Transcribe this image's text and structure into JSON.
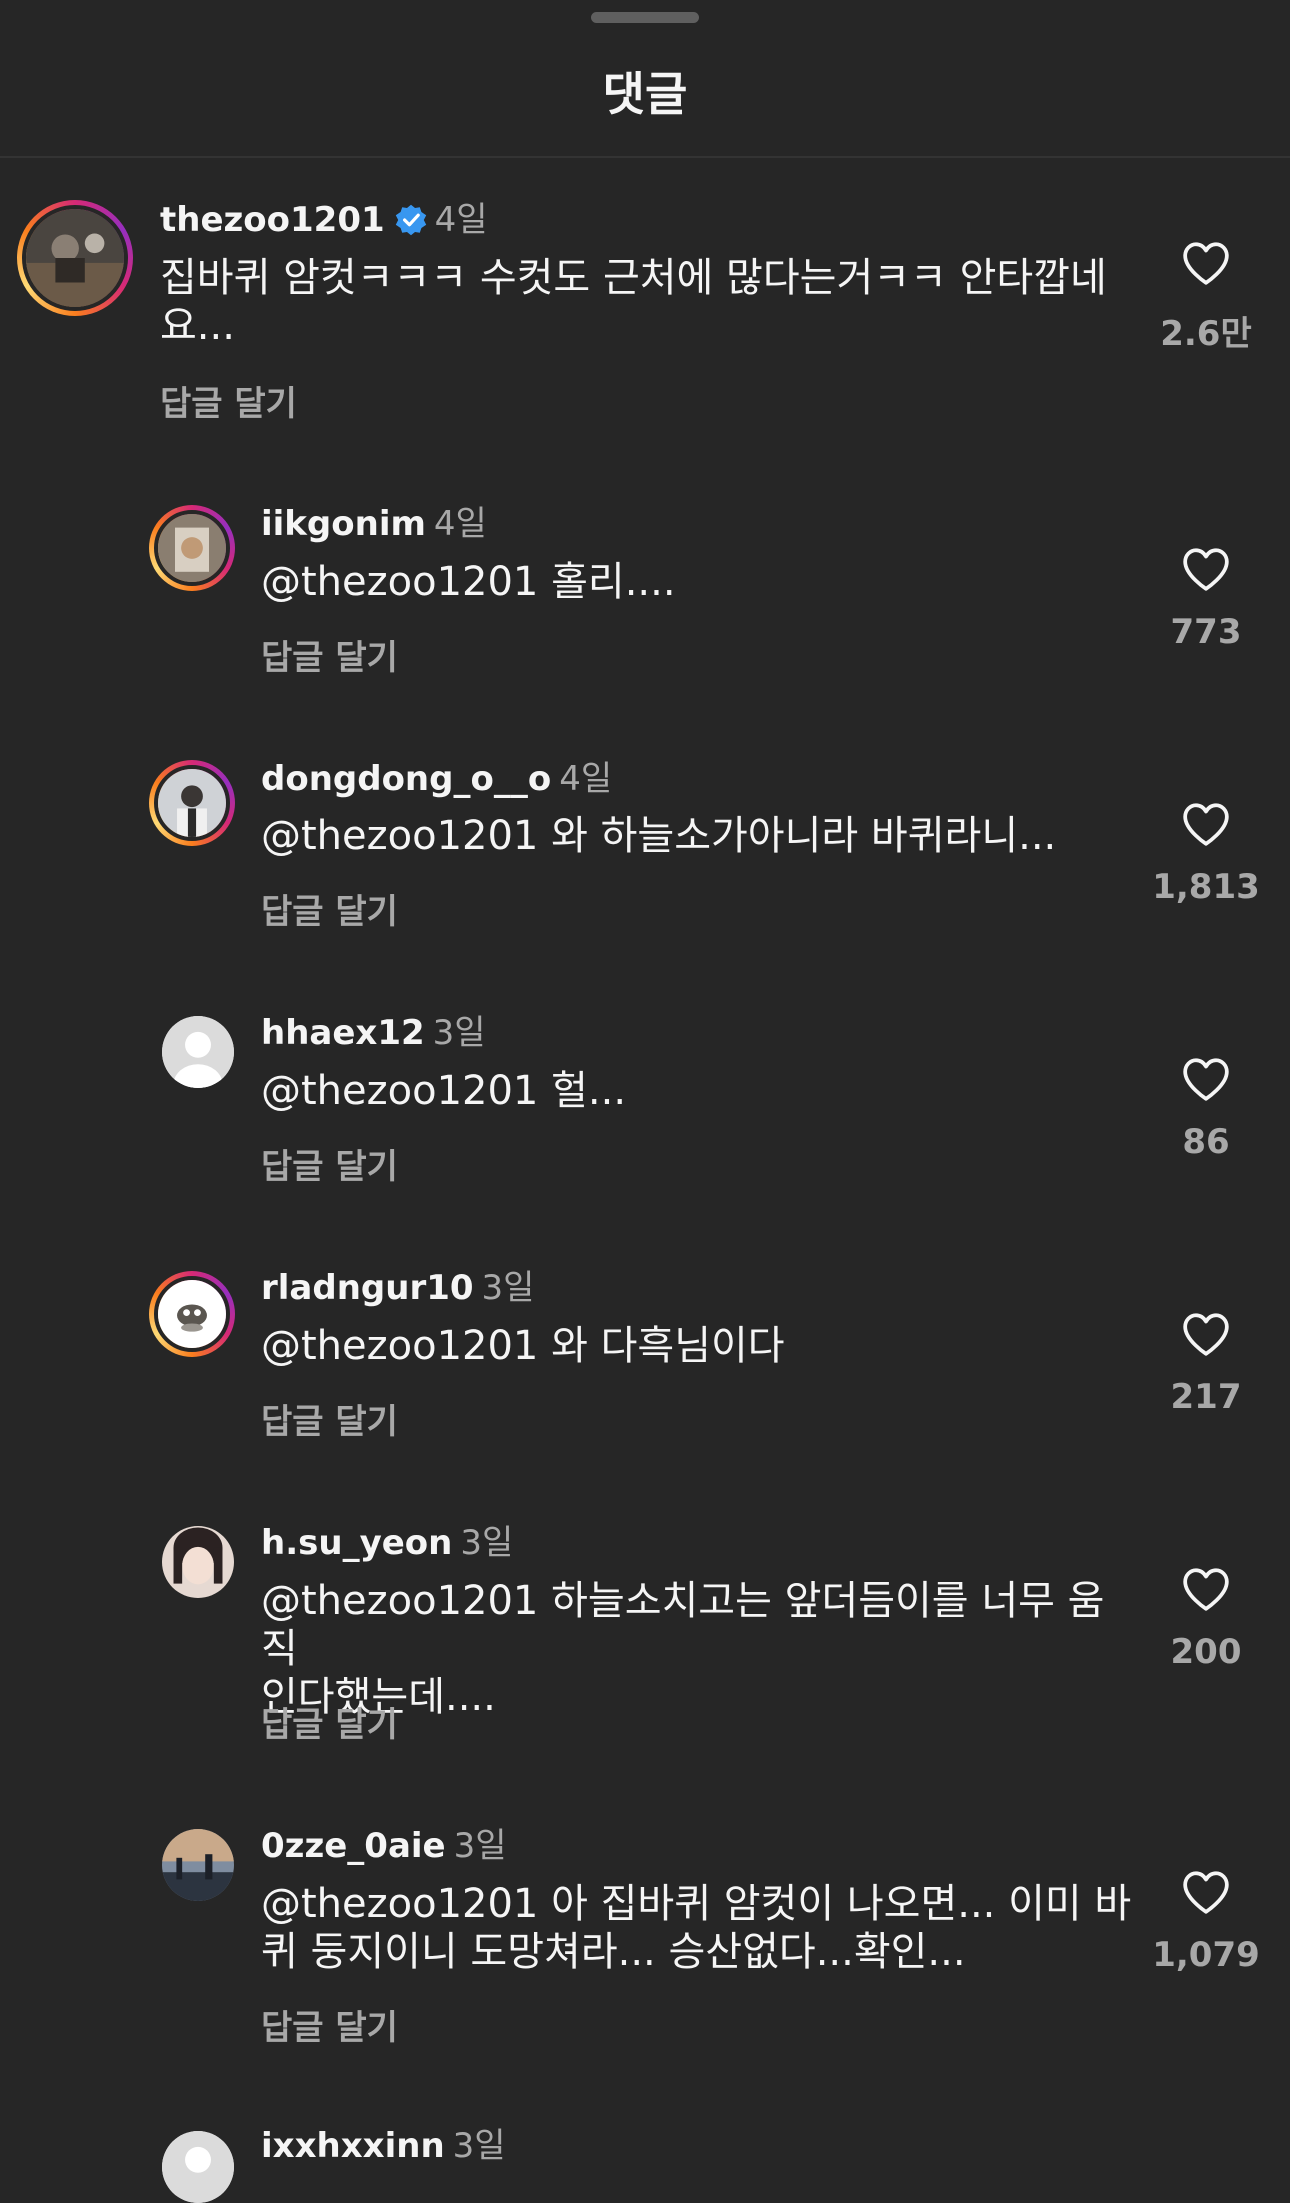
{
  "sheet": {
    "title": "댓글"
  },
  "colors": {
    "background": "#262626",
    "text": "#f5f5f5",
    "muted": "#a8a8a8",
    "verified": "#3897f0"
  },
  "comments": [
    {
      "username": "thezoo1201",
      "verified": true,
      "time": "4일",
      "text_lines": [
        "집바퀴 암컷ㅋㅋㅋ 수컷도 근처에 많다는거ㅋㅋ 안타깝네",
        "요..."
      ],
      "reply_label": "답글 달기",
      "likes": "2.6만"
    },
    {
      "username": "iikgonim",
      "time": "4일",
      "text_lines": [
        "@thezoo1201 홀리...."
      ],
      "reply_label": "답글 달기",
      "likes": "773"
    },
    {
      "username": "dongdong_o__o",
      "time": "4일",
      "text_lines": [
        "@thezoo1201 와 하늘소가아니라 바퀴라니..."
      ],
      "reply_label": "답글 달기",
      "likes": "1,813"
    },
    {
      "username": "hhaex12",
      "time": "3일",
      "text_lines": [
        "@thezoo1201 헐..."
      ],
      "reply_label": "답글 달기",
      "likes": "86"
    },
    {
      "username": "rladngur10",
      "time": "3일",
      "text_lines": [
        "@thezoo1201 와 다흑님이다"
      ],
      "reply_label": "답글 달기",
      "likes": "217"
    },
    {
      "username": "h.su_yeon",
      "time": "3일",
      "text_lines": [
        "@thezoo1201 하늘소치고는 앞더듬이를 너무 움직",
        "인다했는데...."
      ],
      "reply_label": "답글 달기",
      "likes": "200"
    },
    {
      "username": "0zze_0aie",
      "time": "3일",
      "text_lines": [
        "@thezoo1201 아 집바퀴 암컷이 나오면... 이미 바",
        "퀴 둥지이니 도망쳐라... 승산없다...확인..."
      ],
      "reply_label": "답글 달기",
      "likes": "1,079"
    },
    {
      "username": "ixxhxxinn",
      "time": "3일"
    }
  ]
}
